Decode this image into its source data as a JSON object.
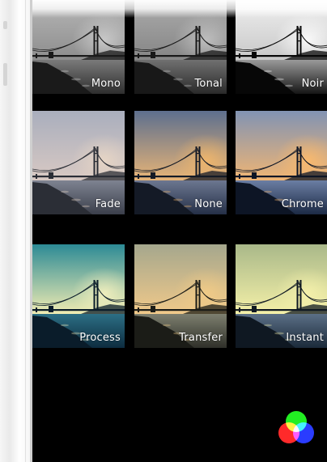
{
  "filters": [
    {
      "label": "Mono",
      "name": "filter-mono",
      "sky": [
        "#bdbdbd",
        "#8d8d8d"
      ],
      "water": [
        "#7a7a7a",
        "#2e2e2e"
      ],
      "land": "#1a1a1a",
      "glow": "#cfcfcf"
    },
    {
      "label": "Tonal",
      "name": "filter-tonal",
      "sky": [
        "#b2b2b2",
        "#858585"
      ],
      "water": [
        "#707070",
        "#2a2a2a"
      ],
      "land": "#181818",
      "glow": "#c5c5c5"
    },
    {
      "label": "Noir",
      "name": "filter-noir",
      "sky": [
        "#f5f5f5",
        "#c8c8c8"
      ],
      "water": [
        "#9a9a9a",
        "#151515"
      ],
      "land": "#070707",
      "glow": "#ffffff"
    },
    {
      "label": "Fade",
      "name": "filter-fade",
      "sky": [
        "#a9aebd",
        "#d8c9c3"
      ],
      "water": [
        "#7e8391",
        "#3b3f4b"
      ],
      "land": "#2b2e36",
      "glow": "#ead8c6"
    },
    {
      "label": "None",
      "name": "filter-none",
      "sky": [
        "#5d6f8e",
        "#e7b477"
      ],
      "water": [
        "#6c7790",
        "#253048"
      ],
      "land": "#141a26",
      "glow": "#f4b86a"
    },
    {
      "label": "Chrome",
      "name": "filter-chrome",
      "sky": [
        "#8193b3",
        "#f0b574"
      ],
      "water": [
        "#6b7ea3",
        "#1c2a45"
      ],
      "land": "#0d1525",
      "glow": "#ffbb6a"
    },
    {
      "label": "Process",
      "name": "filter-process",
      "sky": [
        "#2c8a95",
        "#f0ecb2"
      ],
      "water": [
        "#2c6f85",
        "#0d2c3f"
      ],
      "land": "#0a1c2a",
      "glow": "#f7f2c0"
    },
    {
      "label": "Transfer",
      "name": "filter-transfer",
      "sky": [
        "#a5a78d",
        "#f0c98a"
      ],
      "water": [
        "#7d7f6f",
        "#2f3029"
      ],
      "land": "#1b1c17",
      "glow": "#f3cc86"
    },
    {
      "label": "Instant",
      "name": "filter-instant",
      "sky": [
        "#a9b889",
        "#f4f0a8"
      ],
      "water": [
        "#5b6f86",
        "#1b2a3a"
      ],
      "land": "#0f1822",
      "glow": "#f7f2ac"
    }
  ],
  "filter_icon": {
    "name": "color-filter-icon",
    "colors": {
      "red": "#ff2a2a",
      "green": "#22ee22",
      "blue": "#2a3cff"
    }
  }
}
